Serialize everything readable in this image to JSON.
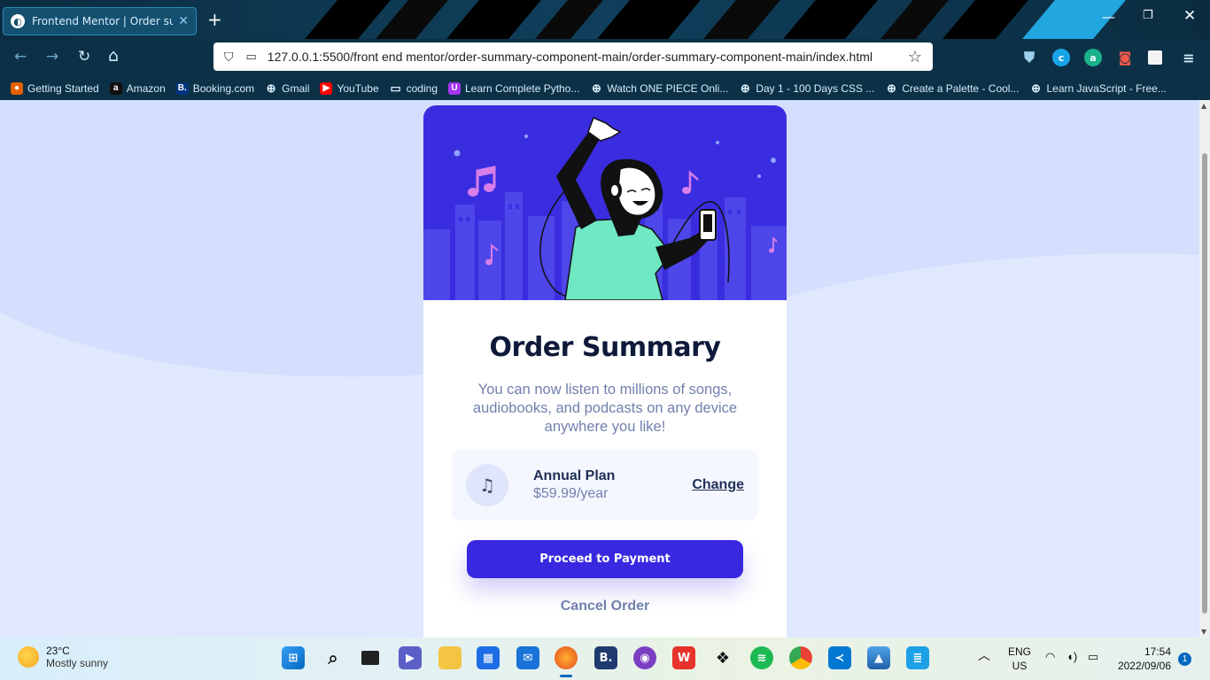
{
  "browser": {
    "tab_title": "Frontend Mentor | Order summ",
    "url": "127.0.0.1:5500/front end mentor/order-summary-component-main/order-summary-component-main/index.html",
    "bookmarks": [
      {
        "label": "Getting Started",
        "icon": "firefox-icon",
        "color": "#e66000"
      },
      {
        "label": "Amazon",
        "icon": "amazon-icon",
        "color": "#111111"
      },
      {
        "label": "Booking.com",
        "icon": "booking-icon",
        "color": "#003580"
      },
      {
        "label": "Gmail",
        "icon": "globe-icon",
        "color": "transparent"
      },
      {
        "label": "YouTube",
        "icon": "youtube-icon",
        "color": "#ff0000"
      },
      {
        "label": "coding",
        "icon": "folder-icon",
        "color": "transparent"
      },
      {
        "label": "Learn Complete Pytho...",
        "icon": "udemy-icon",
        "color": "#a435f0"
      },
      {
        "label": "Watch ONE PIECE Onli...",
        "icon": "globe-icon",
        "color": "transparent"
      },
      {
        "label": "Day 1 - 100 Days CSS ...",
        "icon": "globe-icon",
        "color": "transparent"
      },
      {
        "label": "Create a Palette - Cool...",
        "icon": "globe-icon",
        "color": "transparent"
      },
      {
        "label": "Learn JavaScript - Free...",
        "icon": "globe-icon",
        "color": "transparent"
      }
    ]
  },
  "card": {
    "title": "Order Summary",
    "description": "You can now listen to millions of songs, audiobooks, and podcasts on any device anywhere you like!",
    "plan_name": "Annual Plan",
    "plan_price": "$59.99/year",
    "change_label": "Change",
    "pay_label": "Proceed to Payment",
    "cancel_label": "Cancel Order"
  },
  "colors": {
    "primary": "#3829e0",
    "page_bg": "#e0e8fe",
    "hero_bg": "#3a2de0",
    "text_dark": "#1f2f56",
    "text_muted": "#7180ac"
  },
  "taskbar": {
    "weather_temp": "23°C",
    "weather_condition": "Mostly sunny",
    "language": "ENG",
    "region": "US",
    "time": "17:54",
    "date": "2022/09/06",
    "notification_count": "1"
  }
}
